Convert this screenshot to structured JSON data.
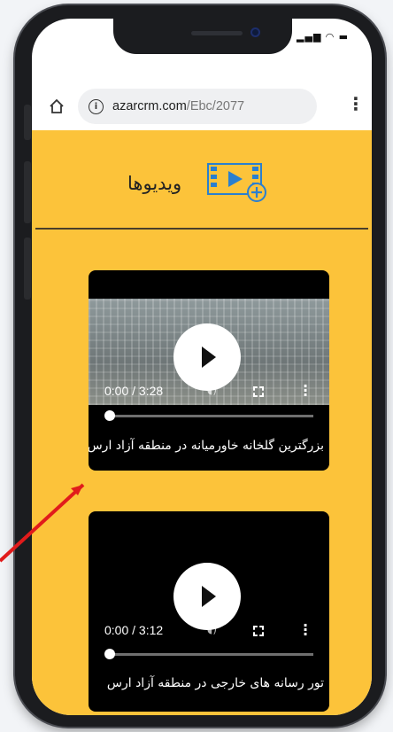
{
  "browser": {
    "url_host": "azarcrm.com",
    "url_path": "/Ebc/2077"
  },
  "status_bar": {
    "icons": [
      "signal-icon",
      "wifi-icon",
      "battery-icon"
    ]
  },
  "section": {
    "title": "ویدیوها",
    "icon": "video-add-icon",
    "accent_color": "#fcc33a",
    "icon_color": "#2a7fd0"
  },
  "videos": [
    {
      "time": "0:00 / 3:28",
      "progress": 0,
      "caption": "بزرگترین گلخانه خاورمیانه در منطقه آزاد ارس"
    },
    {
      "time": "0:00 / 3:12",
      "progress": 0,
      "caption": "تور رسانه های خارجی در منطقه آزاد ارس"
    }
  ],
  "annotation": {
    "arrow_color": "#e11b1b"
  }
}
